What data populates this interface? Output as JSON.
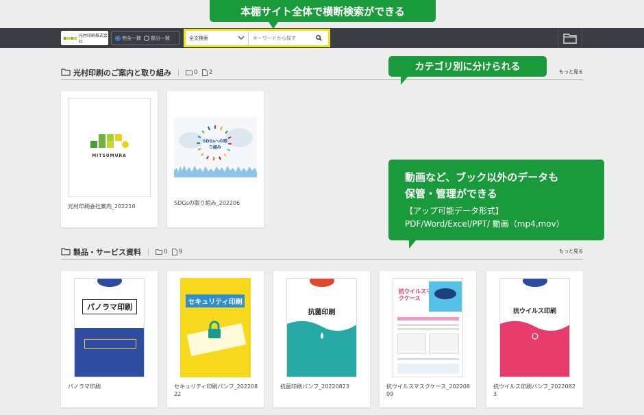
{
  "callouts": {
    "top": "本棚サイト全体で横断検索ができる",
    "category": "カテゴリ別に分けられる",
    "data_line1": "動画など、ブック以外のデータも",
    "data_line2": "保管・管理ができる",
    "data_line3": "【アップ可能データ形式】",
    "data_line4": "PDF/Word/Excel/PPT/ 動画（mp4,mov）"
  },
  "header": {
    "logo_text": "光村印刷株式会社",
    "match_exact": "完全一致",
    "match_partial": "部分一致",
    "scope_value": "全文検索",
    "search_placeholder": "キーワードから探す"
  },
  "sections": [
    {
      "title": "光村印刷のご案内と取り組み",
      "folder_count": "0",
      "file_count": "2",
      "more": "もっと見る",
      "items": [
        {
          "caption": "光村印刷会社案内_202210",
          "thumb_text": "MITSUMURA"
        },
        {
          "caption": "SDGsの取り組み_202206",
          "thumb_text": "SDGsへの取り組み"
        }
      ]
    },
    {
      "title": "製品・サービス資料",
      "folder_count": "0",
      "file_count": "9",
      "more": "もっと見る",
      "items": [
        {
          "caption": "パノラマ印刷",
          "thumb_text": "パノラマ印刷"
        },
        {
          "caption": "セキュリティ印刷パンフ_20220822",
          "thumb_text": "セキュリティ印刷"
        },
        {
          "caption": "抗菌印刷パンフ_20220823",
          "thumb_text": "抗菌印刷"
        },
        {
          "caption": "抗ウイルスマスクケース_20220809",
          "thumb_text": "抗ウイルスマスクケース"
        },
        {
          "caption": "抗ウイルス印刷パンフ_20220823",
          "thumb_text": "抗ウイルス印刷"
        }
      ]
    }
  ],
  "colors": {
    "accent_green": "#1a9b3b",
    "highlight_yellow": "#f2e21a",
    "bar": "#3a3d42"
  }
}
